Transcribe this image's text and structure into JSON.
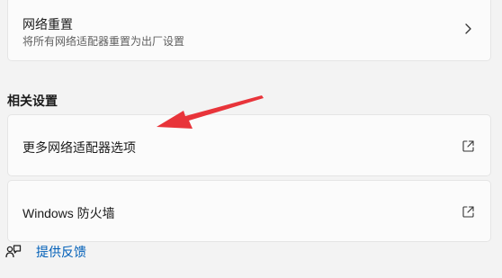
{
  "network_reset": {
    "title": "网络重置",
    "subtitle": "将所有网络适配器重置为出厂设置",
    "icon": "chevron-right-icon"
  },
  "related_settings": {
    "heading": "相关设置",
    "items": [
      {
        "label": "更多网络适配器选项",
        "icon": "open-external-icon"
      },
      {
        "label": "Windows 防火墙",
        "icon": "open-external-icon"
      }
    ]
  },
  "feedback": {
    "label": "提供反馈",
    "icon": "feedback-icon"
  },
  "annotation": {
    "color": "#e8343a",
    "icon": "red-arrow"
  }
}
